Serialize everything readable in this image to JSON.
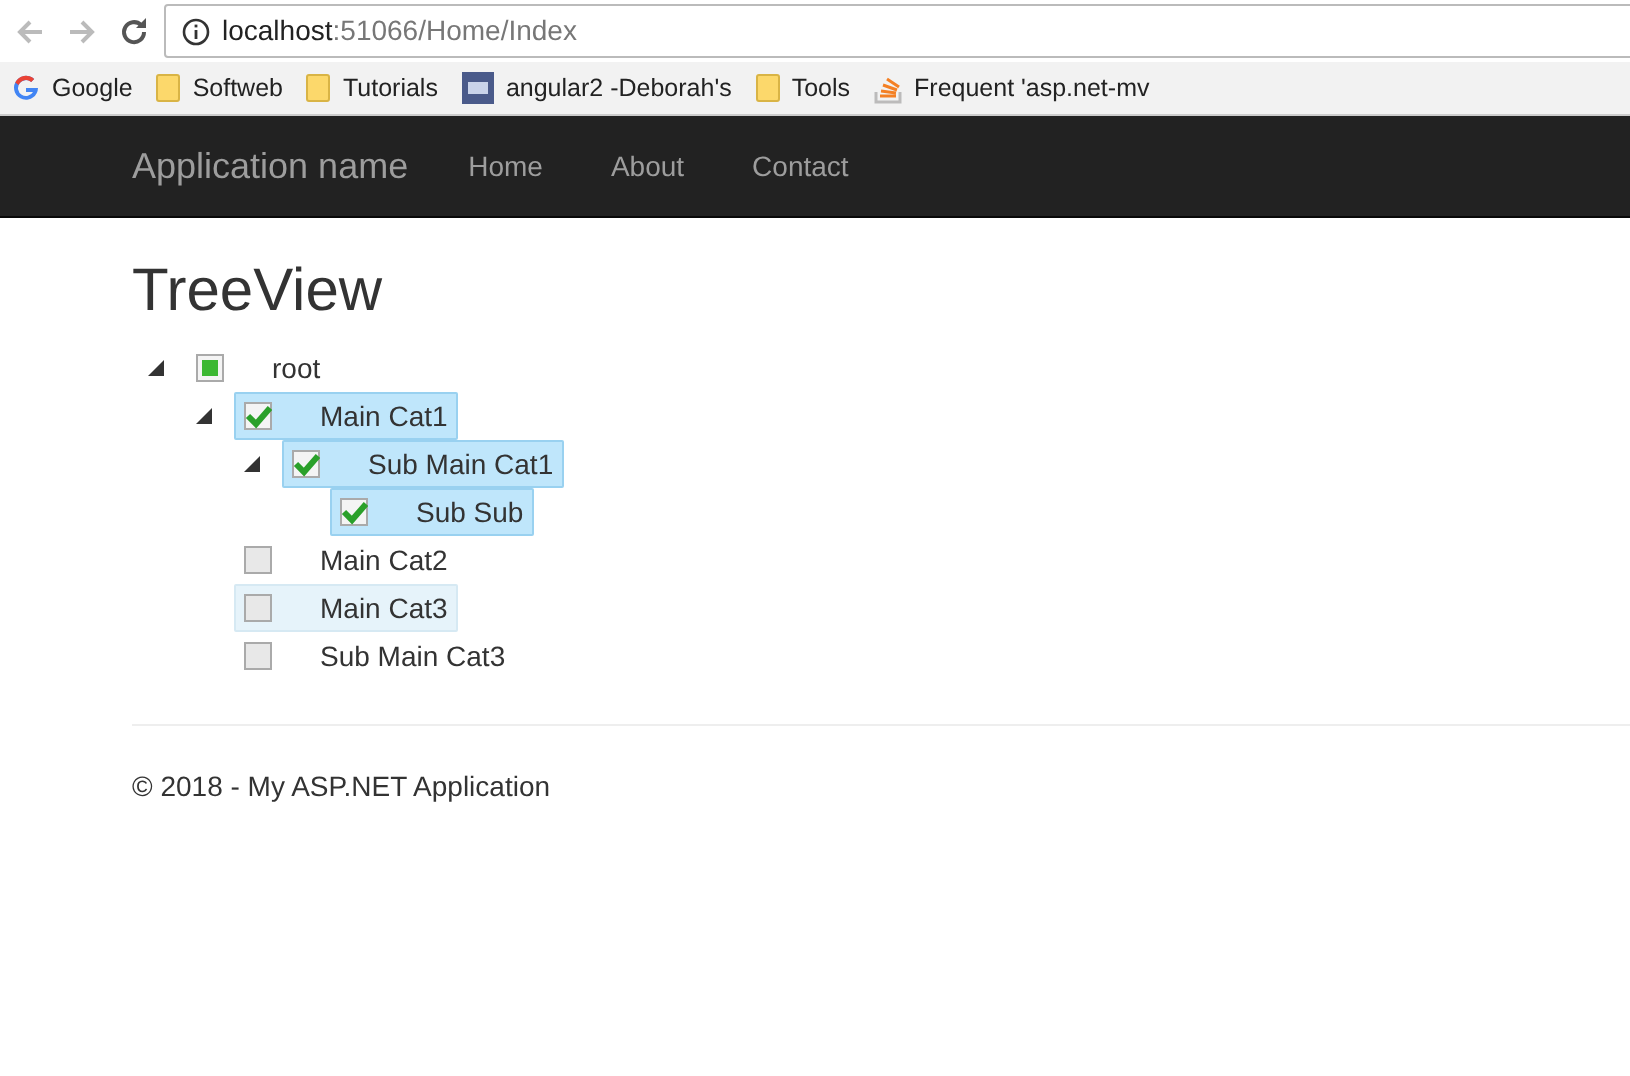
{
  "browser": {
    "address_host": "localhost",
    "address_path": ":51066/Home/Index",
    "bookmarks": [
      {
        "label": "Google",
        "kind": "google"
      },
      {
        "label": "Softweb",
        "kind": "folder"
      },
      {
        "label": "Tutorials",
        "kind": "folder"
      },
      {
        "label": "angular2 -Deborah's",
        "kind": "site"
      },
      {
        "label": "Tools",
        "kind": "folder"
      },
      {
        "label": "Frequent 'asp.net-mv",
        "kind": "stack"
      }
    ]
  },
  "navbar": {
    "brand": "Application name",
    "links": [
      "Home",
      "About",
      "Contact"
    ]
  },
  "page": {
    "title": "TreeView"
  },
  "tree": [
    {
      "label": "root",
      "checked": false,
      "indeterminate": true,
      "selected": false,
      "hovered": false,
      "expanded": true,
      "children": [
        {
          "label": "Main Cat1",
          "checked": true,
          "indeterminate": false,
          "selected": true,
          "hovered": false,
          "expanded": true,
          "children": [
            {
              "label": "Sub Main Cat1",
              "checked": true,
              "indeterminate": false,
              "selected": true,
              "hovered": false,
              "expanded": true,
              "children": [
                {
                  "label": "Sub Sub",
                  "checked": true,
                  "indeterminate": false,
                  "selected": true,
                  "hovered": false
                }
              ]
            }
          ]
        },
        {
          "label": "Main Cat2",
          "checked": false,
          "indeterminate": false,
          "selected": false,
          "hovered": false
        },
        {
          "label": "Main Cat3",
          "checked": false,
          "indeterminate": false,
          "selected": false,
          "hovered": true
        },
        {
          "label": "Sub Main Cat3",
          "checked": false,
          "indeterminate": false,
          "selected": false,
          "hovered": false
        }
      ]
    }
  ],
  "footer": {
    "text": "© 2018 - My ASP.NET Application"
  }
}
